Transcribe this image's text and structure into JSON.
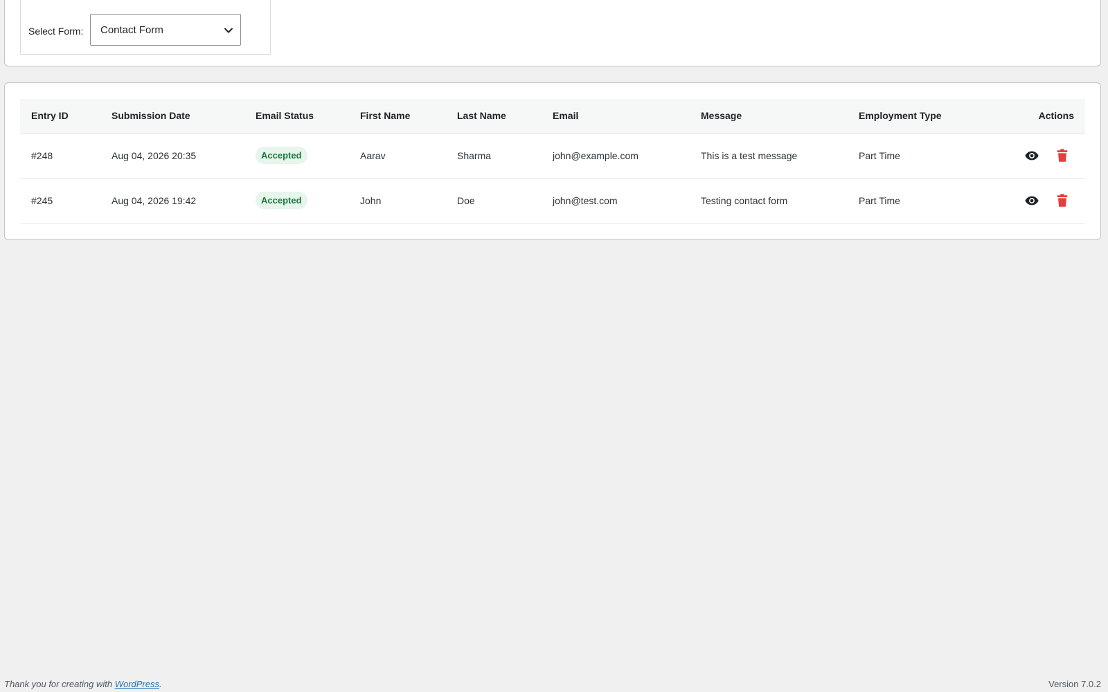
{
  "filter": {
    "label": "Select Form:",
    "selected_form": "Contact Form"
  },
  "table": {
    "headers": {
      "entry_id": "Entry ID",
      "submission_date": "Submission Date",
      "email_status": "Email Status",
      "first_name": "First Name",
      "last_name": "Last Name",
      "email": "Email",
      "message": "Message",
      "employment_type": "Employment Type",
      "actions": "Actions"
    },
    "rows": [
      {
        "entry_id": "#248",
        "submission_date": "Aug 04, 2026 20:35",
        "email_status": "Accepted",
        "first_name": "Aarav",
        "last_name": "Sharma",
        "email": "john@example.com",
        "message": "This is a test message",
        "employment_type": "Part Time"
      },
      {
        "entry_id": "#245",
        "submission_date": "Aug 04, 2026 19:42",
        "email_status": "Accepted",
        "first_name": "John",
        "last_name": "Doe",
        "email": "john@test.com",
        "message": "Testing contact form",
        "employment_type": "Part Time"
      }
    ],
    "icons": {
      "view": "eye-icon",
      "delete": "trash-icon"
    }
  },
  "colors": {
    "status_accepted_bg": "#e7f5ec",
    "status_accepted_text": "#1e7a3c",
    "delete": "#e53e3e",
    "link": "#2271b1"
  },
  "footer": {
    "thanks_prefix": "Thank you for creating with ",
    "thanks_link": "WordPress",
    "thanks_suffix": ".",
    "version": "Version 7.0.2"
  }
}
